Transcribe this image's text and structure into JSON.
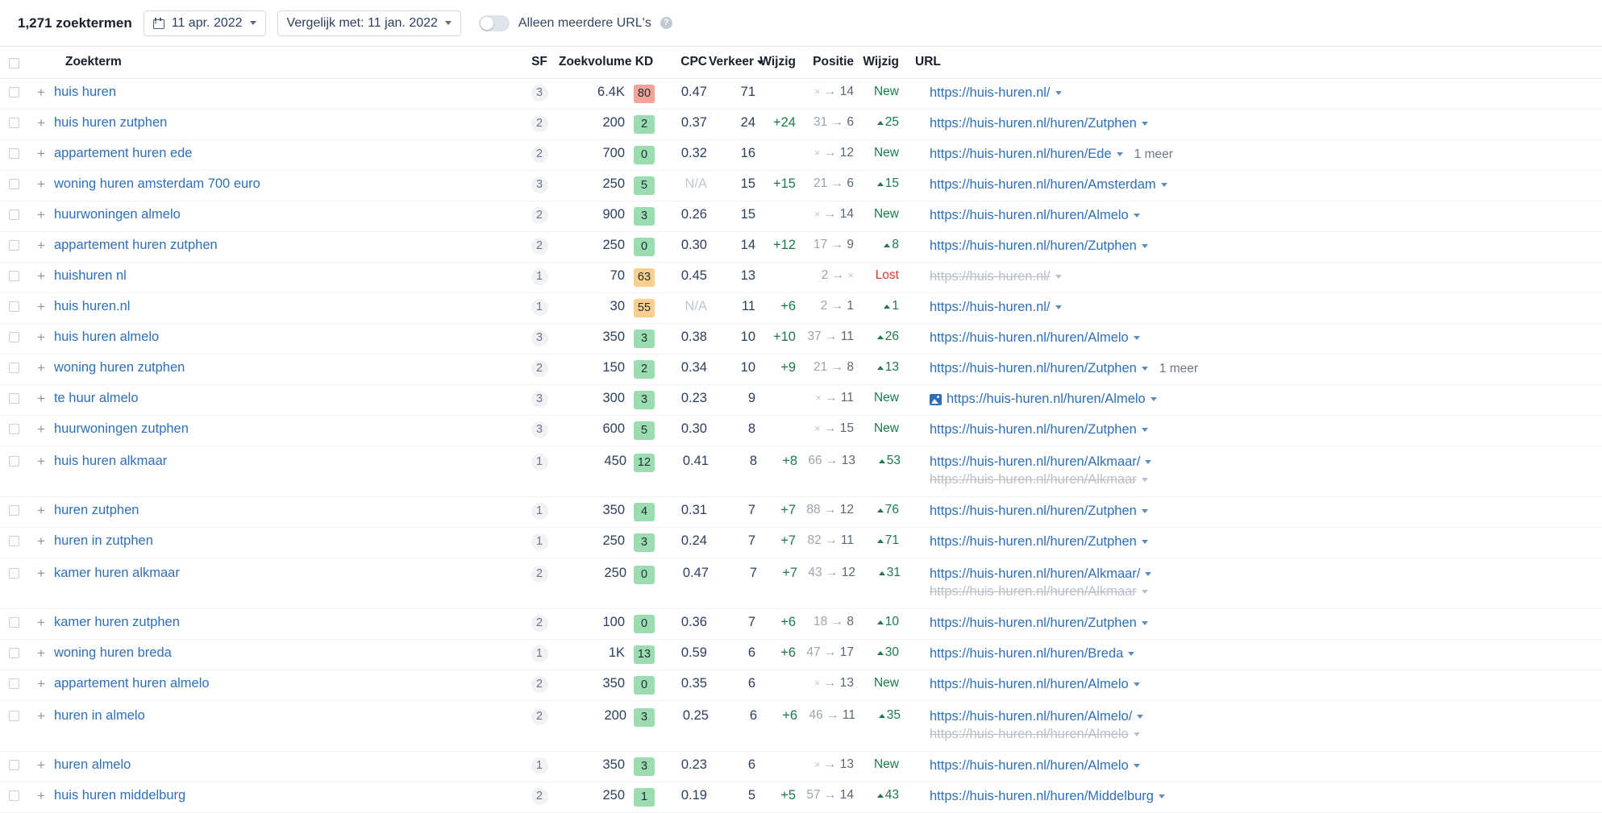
{
  "toolbar": {
    "keyword_count": "1,271 zoektermen",
    "date_label": "11 apr. 2022",
    "compare_label": "Vergelijk met: 11 jan. 2022",
    "toggle_label": "Alleen meerdere URL's",
    "help_icon": "help-icon",
    "calendar_icon": "calendar-icon"
  },
  "table": {
    "headers": {
      "keyword": "Zoekterm",
      "sf": "SF",
      "volume": "Zoekvolume",
      "kd": "KD",
      "cpc": "CPC",
      "traffic": "Verkeer",
      "traffic_change": "Wijzig",
      "position": "Positie",
      "position_change": "Wijzig",
      "url": "URL"
    },
    "sorted_column": "Verkeer",
    "rows": [
      {
        "keyword": "huis huren",
        "sf": "3",
        "volume": "6.4K",
        "kd": "80",
        "kd_color": "red",
        "cpc": "0.47",
        "traffic": "71",
        "traffic_change": "",
        "pos_from": "×",
        "pos_to": "14",
        "pos_change": "New",
        "pos_change_type": "new",
        "urls": [
          {
            "text": "https://huis-huren.nl/",
            "dim": false,
            "serp_icon": false
          }
        ],
        "more": ""
      },
      {
        "keyword": "huis huren zutphen",
        "sf": "2",
        "volume": "200",
        "kd": "2",
        "kd_color": "green",
        "cpc": "0.37",
        "traffic": "24",
        "traffic_change": "+24",
        "pos_from": "31",
        "pos_to": "6",
        "pos_change": "25",
        "pos_change_type": "up",
        "urls": [
          {
            "text": "https://huis-huren.nl/huren/Zutphen",
            "dim": false,
            "serp_icon": false
          }
        ],
        "more": ""
      },
      {
        "keyword": "appartement huren ede",
        "sf": "2",
        "volume": "700",
        "kd": "0",
        "kd_color": "green",
        "cpc": "0.32",
        "traffic": "16",
        "traffic_change": "",
        "pos_from": "×",
        "pos_to": "12",
        "pos_change": "New",
        "pos_change_type": "new",
        "urls": [
          {
            "text": "https://huis-huren.nl/huren/Ede",
            "dim": false,
            "serp_icon": false
          }
        ],
        "more": "1 meer"
      },
      {
        "keyword": "woning huren amsterdam 700 euro",
        "sf": "3",
        "volume": "250",
        "kd": "5",
        "kd_color": "green",
        "cpc": "N/A",
        "cpc_na": true,
        "traffic": "15",
        "traffic_change": "+15",
        "pos_from": "21",
        "pos_to": "6",
        "pos_change": "15",
        "pos_change_type": "up",
        "urls": [
          {
            "text": "https://huis-huren.nl/huren/Amsterdam",
            "dim": false,
            "serp_icon": false
          }
        ],
        "more": ""
      },
      {
        "keyword": "huurwoningen almelo",
        "sf": "2",
        "volume": "900",
        "kd": "3",
        "kd_color": "green",
        "cpc": "0.26",
        "traffic": "15",
        "traffic_change": "",
        "pos_from": "×",
        "pos_to": "14",
        "pos_change": "New",
        "pos_change_type": "new",
        "urls": [
          {
            "text": "https://huis-huren.nl/huren/Almelo",
            "dim": false,
            "serp_icon": false
          }
        ],
        "more": ""
      },
      {
        "keyword": "appartement huren zutphen",
        "sf": "2",
        "volume": "250",
        "kd": "0",
        "kd_color": "green",
        "cpc": "0.30",
        "traffic": "14",
        "traffic_change": "+12",
        "pos_from": "17",
        "pos_to": "9",
        "pos_change": "8",
        "pos_change_type": "up",
        "urls": [
          {
            "text": "https://huis-huren.nl/huren/Zutphen",
            "dim": false,
            "serp_icon": false
          }
        ],
        "more": ""
      },
      {
        "keyword": "huishuren nl",
        "sf": "1",
        "volume": "70",
        "kd": "63",
        "kd_color": "orange",
        "cpc": "0.45",
        "traffic": "13",
        "traffic_change": "",
        "pos_from": "2",
        "pos_to": "×",
        "pos_change": "Lost",
        "pos_change_type": "lost",
        "urls": [
          {
            "text": "https://huis-huren.nl/",
            "dim": true,
            "serp_icon": false
          }
        ],
        "more": ""
      },
      {
        "keyword": "huis huren.nl",
        "sf": "1",
        "volume": "30",
        "kd": "55",
        "kd_color": "orange",
        "cpc": "N/A",
        "cpc_na": true,
        "traffic": "11",
        "traffic_change": "+6",
        "pos_from": "2",
        "pos_to": "1",
        "pos_change": "1",
        "pos_change_type": "up",
        "urls": [
          {
            "text": "https://huis-huren.nl/",
            "dim": false,
            "serp_icon": false
          }
        ],
        "more": ""
      },
      {
        "keyword": "huis huren almelo",
        "sf": "3",
        "volume": "350",
        "kd": "3",
        "kd_color": "green",
        "cpc": "0.38",
        "traffic": "10",
        "traffic_change": "+10",
        "pos_from": "37",
        "pos_to": "11",
        "pos_change": "26",
        "pos_change_type": "up",
        "urls": [
          {
            "text": "https://huis-huren.nl/huren/Almelo",
            "dim": false,
            "serp_icon": false
          }
        ],
        "more": ""
      },
      {
        "keyword": "woning huren zutphen",
        "sf": "2",
        "volume": "150",
        "kd": "2",
        "kd_color": "green",
        "cpc": "0.34",
        "traffic": "10",
        "traffic_change": "+9",
        "pos_from": "21",
        "pos_to": "8",
        "pos_change": "13",
        "pos_change_type": "up",
        "urls": [
          {
            "text": "https://huis-huren.nl/huren/Zutphen",
            "dim": false,
            "serp_icon": false
          }
        ],
        "more": "1 meer"
      },
      {
        "keyword": "te huur almelo",
        "sf": "3",
        "volume": "300",
        "kd": "3",
        "kd_color": "green",
        "cpc": "0.23",
        "traffic": "9",
        "traffic_change": "",
        "pos_from": "×",
        "pos_to": "11",
        "pos_change": "New",
        "pos_change_type": "new",
        "urls": [
          {
            "text": "https://huis-huren.nl/huren/Almelo",
            "dim": false,
            "serp_icon": true
          }
        ],
        "more": ""
      },
      {
        "keyword": "huurwoningen zutphen",
        "sf": "3",
        "volume": "600",
        "kd": "5",
        "kd_color": "green",
        "cpc": "0.30",
        "traffic": "8",
        "traffic_change": "",
        "pos_from": "×",
        "pos_to": "15",
        "pos_change": "New",
        "pos_change_type": "new",
        "urls": [
          {
            "text": "https://huis-huren.nl/huren/Zutphen",
            "dim": false,
            "serp_icon": false
          }
        ],
        "more": ""
      },
      {
        "keyword": "huis huren alkmaar",
        "sf": "1",
        "volume": "450",
        "kd": "12",
        "kd_color": "green",
        "cpc": "0.41",
        "traffic": "8",
        "traffic_change": "+8",
        "pos_from": "66",
        "pos_to": "13",
        "pos_change": "53",
        "pos_change_type": "up",
        "urls": [
          {
            "text": "https://huis-huren.nl/huren/Alkmaar/",
            "dim": false,
            "serp_icon": false
          },
          {
            "text": "https://huis-huren.nl/huren/Alkmaar",
            "dim": true,
            "serp_icon": false
          }
        ],
        "more": ""
      },
      {
        "keyword": "huren zutphen",
        "sf": "1",
        "volume": "350",
        "kd": "4",
        "kd_color": "green",
        "cpc": "0.31",
        "traffic": "7",
        "traffic_change": "+7",
        "pos_from": "88",
        "pos_to": "12",
        "pos_change": "76",
        "pos_change_type": "up",
        "urls": [
          {
            "text": "https://huis-huren.nl/huren/Zutphen",
            "dim": false,
            "serp_icon": false
          }
        ],
        "more": ""
      },
      {
        "keyword": "huren in zutphen",
        "sf": "1",
        "volume": "250",
        "kd": "3",
        "kd_color": "green",
        "cpc": "0.24",
        "traffic": "7",
        "traffic_change": "+7",
        "pos_from": "82",
        "pos_to": "11",
        "pos_change": "71",
        "pos_change_type": "up",
        "urls": [
          {
            "text": "https://huis-huren.nl/huren/Zutphen",
            "dim": false,
            "serp_icon": false
          }
        ],
        "more": ""
      },
      {
        "keyword": "kamer huren alkmaar",
        "sf": "2",
        "volume": "250",
        "kd": "0",
        "kd_color": "green",
        "cpc": "0.47",
        "traffic": "7",
        "traffic_change": "+7",
        "pos_from": "43",
        "pos_to": "12",
        "pos_change": "31",
        "pos_change_type": "up",
        "urls": [
          {
            "text": "https://huis-huren.nl/huren/Alkmaar/",
            "dim": false,
            "serp_icon": false
          },
          {
            "text": "https://huis-huren.nl/huren/Alkmaar",
            "dim": true,
            "serp_icon": false
          }
        ],
        "more": ""
      },
      {
        "keyword": "kamer huren zutphen",
        "sf": "2",
        "volume": "100",
        "kd": "0",
        "kd_color": "green",
        "cpc": "0.36",
        "traffic": "7",
        "traffic_change": "+6",
        "pos_from": "18",
        "pos_to": "8",
        "pos_change": "10",
        "pos_change_type": "up",
        "urls": [
          {
            "text": "https://huis-huren.nl/huren/Zutphen",
            "dim": false,
            "serp_icon": false
          }
        ],
        "more": ""
      },
      {
        "keyword": "woning huren breda",
        "sf": "1",
        "volume": "1K",
        "kd": "13",
        "kd_color": "green",
        "cpc": "0.59",
        "traffic": "6",
        "traffic_change": "+6",
        "pos_from": "47",
        "pos_to": "17",
        "pos_change": "30",
        "pos_change_type": "up",
        "urls": [
          {
            "text": "https://huis-huren.nl/huren/Breda",
            "dim": false,
            "serp_icon": false
          }
        ],
        "more": ""
      },
      {
        "keyword": "appartement huren almelo",
        "sf": "2",
        "volume": "350",
        "kd": "0",
        "kd_color": "green",
        "cpc": "0.35",
        "traffic": "6",
        "traffic_change": "",
        "pos_from": "×",
        "pos_to": "13",
        "pos_change": "New",
        "pos_change_type": "new",
        "urls": [
          {
            "text": "https://huis-huren.nl/huren/Almelo",
            "dim": false,
            "serp_icon": false
          }
        ],
        "more": ""
      },
      {
        "keyword": "huren in almelo",
        "sf": "2",
        "volume": "200",
        "kd": "3",
        "kd_color": "green",
        "cpc": "0.25",
        "traffic": "6",
        "traffic_change": "+6",
        "pos_from": "46",
        "pos_to": "11",
        "pos_change": "35",
        "pos_change_type": "up",
        "urls": [
          {
            "text": "https://huis-huren.nl/huren/Almelo/",
            "dim": false,
            "serp_icon": false
          },
          {
            "text": "https://huis-huren.nl/huren/Almelo",
            "dim": true,
            "serp_icon": false
          }
        ],
        "more": ""
      },
      {
        "keyword": "huren almelo",
        "sf": "1",
        "volume": "350",
        "kd": "3",
        "kd_color": "green",
        "cpc": "0.23",
        "traffic": "6",
        "traffic_change": "",
        "pos_from": "×",
        "pos_to": "13",
        "pos_change": "New",
        "pos_change_type": "new",
        "urls": [
          {
            "text": "https://huis-huren.nl/huren/Almelo",
            "dim": false,
            "serp_icon": false
          }
        ],
        "more": ""
      },
      {
        "keyword": "huis huren middelburg",
        "sf": "2",
        "volume": "250",
        "kd": "1",
        "kd_color": "green",
        "cpc": "0.19",
        "traffic": "5",
        "traffic_change": "+5",
        "pos_from": "57",
        "pos_to": "14",
        "pos_change": "43",
        "pos_change_type": "up",
        "urls": [
          {
            "text": "https://huis-huren.nl/huren/Middelburg",
            "dim": false,
            "serp_icon": false
          }
        ],
        "more": ""
      }
    ]
  },
  "colors": {
    "link": "#2f6fb5",
    "positive": "#1a7a49",
    "negative": "#d03a35",
    "kd_green": "#9bdcb0",
    "kd_orange": "#f8cf8d",
    "kd_red": "#f5a397"
  }
}
